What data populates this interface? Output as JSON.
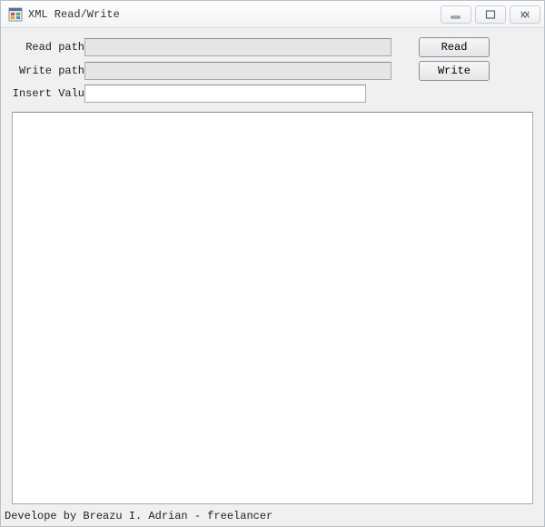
{
  "window": {
    "title": "XML Read/Write"
  },
  "form": {
    "read_path_label": "Read path",
    "read_path_value": "",
    "write_path_label": "Write path",
    "write_path_value": "",
    "insert_value_label": "Insert Valu",
    "insert_value_text": "",
    "output_text": ""
  },
  "buttons": {
    "read": "Read",
    "write": "Write"
  },
  "footer": {
    "text": "Develope by Breazu I. Adrian - freelancer"
  },
  "icons": {
    "app": "app-icon",
    "minimize": "minimize",
    "maximize": "maximize",
    "close": "close"
  }
}
